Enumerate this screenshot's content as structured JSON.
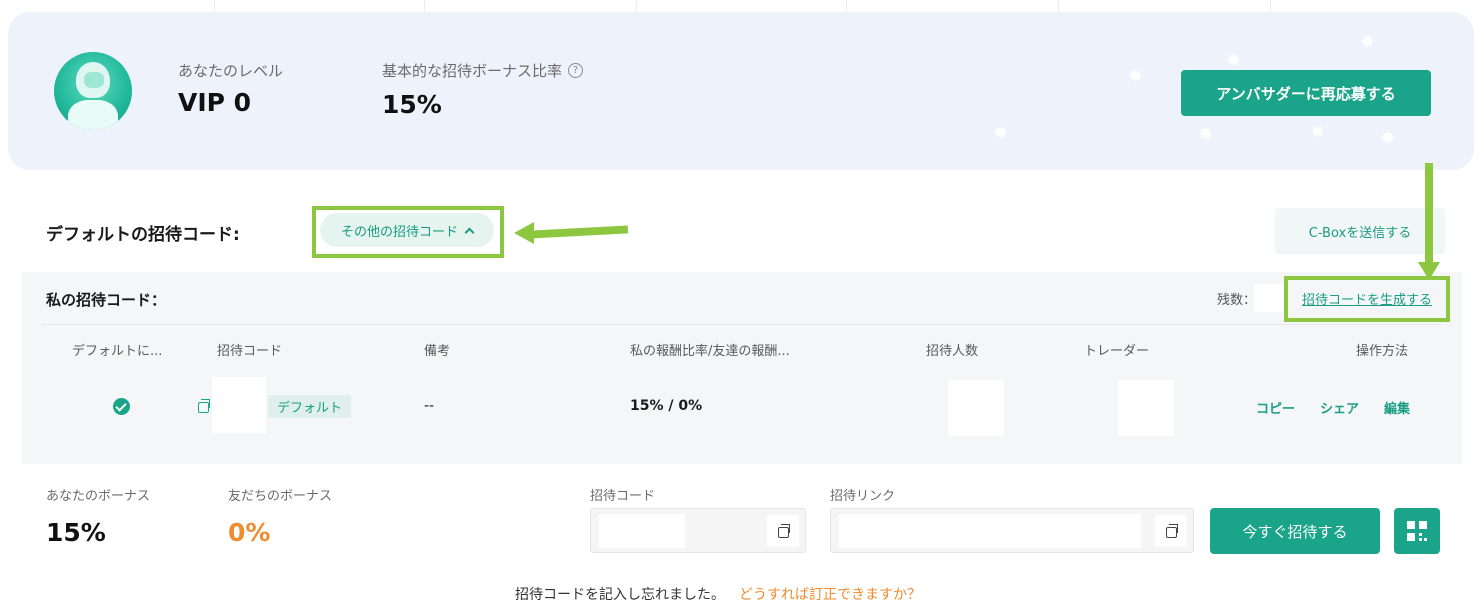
{
  "banner": {
    "level_label": "あなたのレベル",
    "level_value": "VIP 0",
    "rate_label": "基本的な招待ボーナス比率",
    "rate_value": "15%",
    "reapply_button": "アンバサダーに再応募する"
  },
  "default_code": {
    "title": "デフォルトの招待コード:",
    "other_codes_button": "その他の招待コード",
    "cbox_button": "C-Boxを送信する"
  },
  "my_codes": {
    "title": "私の招待コード：",
    "remaining_label": "残数：",
    "generate_link": "招待コードを生成する",
    "columns": [
      "デフォルトに...",
      "招待コード",
      "備考",
      "私の報酬比率/友達の報酬...",
      "招待人数",
      "トレーダー",
      "操作方法"
    ],
    "row": {
      "tag": "デフォルト",
      "note": "--",
      "ratio": "15% / 0%",
      "actions": [
        "コピー",
        "シェア",
        "編集"
      ]
    }
  },
  "bonus": {
    "your_label": "あなたのボーナス",
    "your_value": "15%",
    "friend_label": "友だちのボーナス",
    "friend_value": "0%",
    "code_label": "招待コード",
    "link_label": "招待リンク",
    "invite_button": "今すぐ招待する"
  },
  "footer": {
    "note": "招待コードを記入し忘れました。",
    "link": "どうすれば訂正できますか？"
  },
  "colors": {
    "accent": "#1aa58a",
    "annotation": "#8dc63f",
    "friend_bonus": "#f08c2e"
  }
}
